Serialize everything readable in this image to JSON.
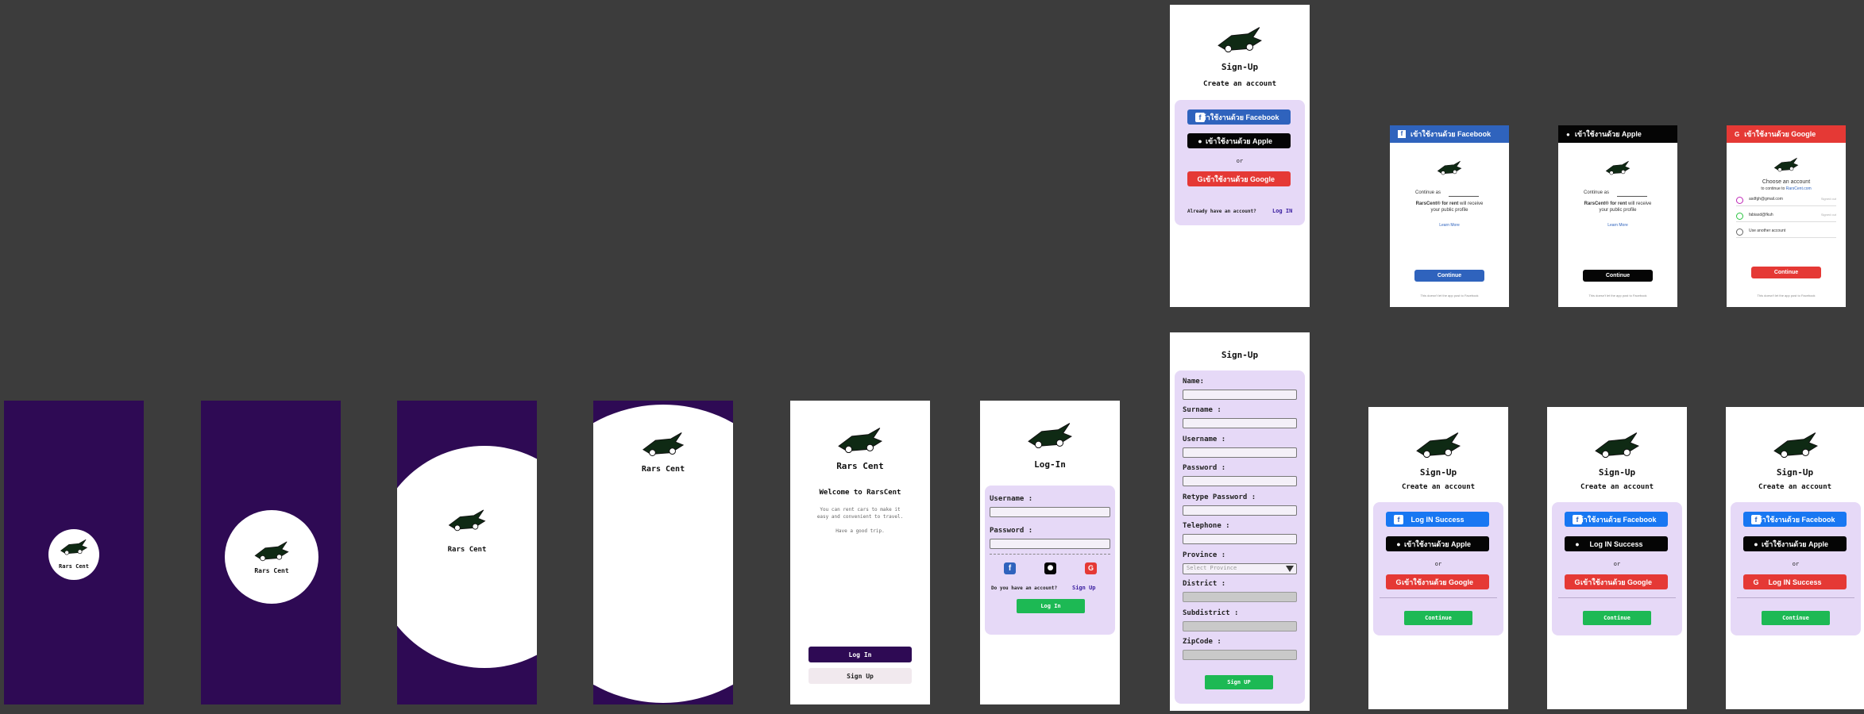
{
  "brand": {
    "name": "Rars Cent",
    "logo_icon": "car-logo-icon",
    "colors": {
      "purple": "#2e0a54",
      "panel": "#e6d9f7",
      "facebook": "#2f63bd",
      "apple": "#050505",
      "google": "#e53935",
      "green": "#1db954"
    }
  },
  "welcome": {
    "title": "Rars Cent",
    "heading": "Welcome to RarsCent",
    "body1": "You can rent cars to make it",
    "body2": "easy and convenient to travel.",
    "body3": "Have a good trip.",
    "login_btn": "Log In",
    "signup_btn": "Sign Up"
  },
  "login": {
    "title": "Log-In",
    "username_label": "Username :",
    "password_label": "Password :",
    "no_account": "Do you have an account?",
    "signup_link": "Sign Up",
    "login_btn": "Log In"
  },
  "signup_social": {
    "title": "Sign-Up",
    "subtitle": "Create an account",
    "facebook": "เข้าใช้งานด้วย Facebook",
    "apple": "เข้าใช้งานด้วย Apple",
    "google": "เข้าใช้งานด้วย Google",
    "or": "or",
    "already": "Already have an account?",
    "login_link": "Log IN",
    "fb_success": "Log IN Success",
    "success": "Log IN Success",
    "continue": "Continue"
  },
  "signup_form": {
    "title": "Sign-Up",
    "name": "Name:",
    "surname": "Surname :",
    "username": "Username :",
    "password": "Password :",
    "retype": "Retype Password :",
    "telephone": "Telephone :",
    "province": "Province :",
    "province_placeholder": "Select Province",
    "district": "District :",
    "subdistrict": "Subdistrict :",
    "zipcode": "ZipCode :",
    "submit": "Sign UP"
  },
  "oauth": {
    "fb_header": "เข้าใช้งานด้วย Facebook",
    "apple_header": "เข้าใช้งานด้วย Apple",
    "google_header": "เข้าใช้งานด้วย Google",
    "continue_as": "Continue as",
    "receive_bold": "RarsCent® for rent",
    "receive_rest": "will receive",
    "public_profile": "your public profile",
    "learn_more": "Learn More",
    "continue": "Continue",
    "footer": "This doesn't let the app post to Facebook",
    "choose": "Choose an account",
    "to_continue": "to continue to",
    "site": "RarsCent.com",
    "acc1": "asdfgh@gmail.com",
    "acc2": "fabiasd@fkuh",
    "acc_status": "Signed out",
    "other": "Use another account"
  }
}
